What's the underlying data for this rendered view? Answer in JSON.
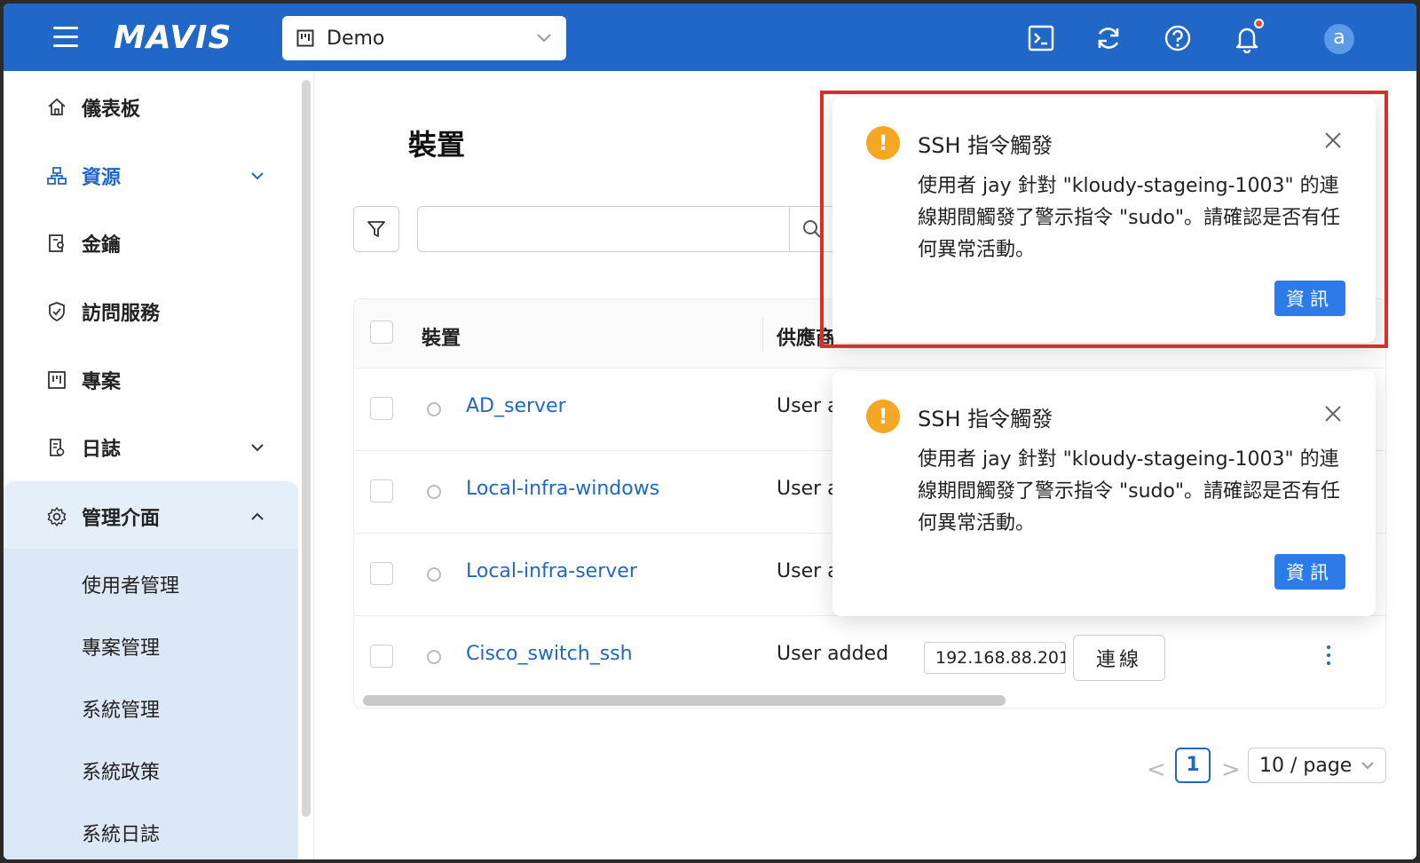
{
  "header": {
    "logo": "MAVIS",
    "project_select": "Demo"
  },
  "sidebar": {
    "items": [
      {
        "label": "儀表板"
      },
      {
        "label": "資源"
      },
      {
        "label": "金鑰"
      },
      {
        "label": "訪問服務"
      },
      {
        "label": "專案"
      },
      {
        "label": "日誌"
      },
      {
        "label": "管理介面"
      }
    ],
    "admin_sub": [
      "使用者管理",
      "專案管理",
      "系統管理",
      "系統政策",
      "系統日誌"
    ]
  },
  "main": {
    "title": "裝置",
    "search": {
      "value": ""
    },
    "table": {
      "headers": [
        "裝置",
        "供應商"
      ],
      "rows": [
        {
          "device": "AD_server",
          "provider": "User a"
        },
        {
          "device": "Local-infra-windows",
          "provider": "User a"
        },
        {
          "device": "Local-infra-server",
          "provider": "User a"
        },
        {
          "device": "Cisco_switch_ssh",
          "provider": "User added",
          "ip": "192.168.88.201",
          "connect": "連線"
        }
      ]
    },
    "pagination": {
      "prev": "<",
      "current": "1",
      "next": ">",
      "page_size": "10 / page"
    }
  },
  "notifications": [
    {
      "title": "SSH 指令觸發",
      "body": "使用者 jay 針對 \"kloudy-stageing-1003\" 的連線期間觸發了警示指令 \"sudo\"。請確認是否有任何異常活動。",
      "button": "資訊"
    },
    {
      "title": "SSH 指令觸發",
      "body": "使用者 jay 針對 \"kloudy-stageing-1003\" 的連線期間觸發了警示指令 \"sudo\"。請確認是否有任何異常活動。",
      "button": "資訊"
    }
  ],
  "colors": {
    "brand": "#2067c7",
    "warning": "#f5a623",
    "highlight": "#d93025"
  }
}
